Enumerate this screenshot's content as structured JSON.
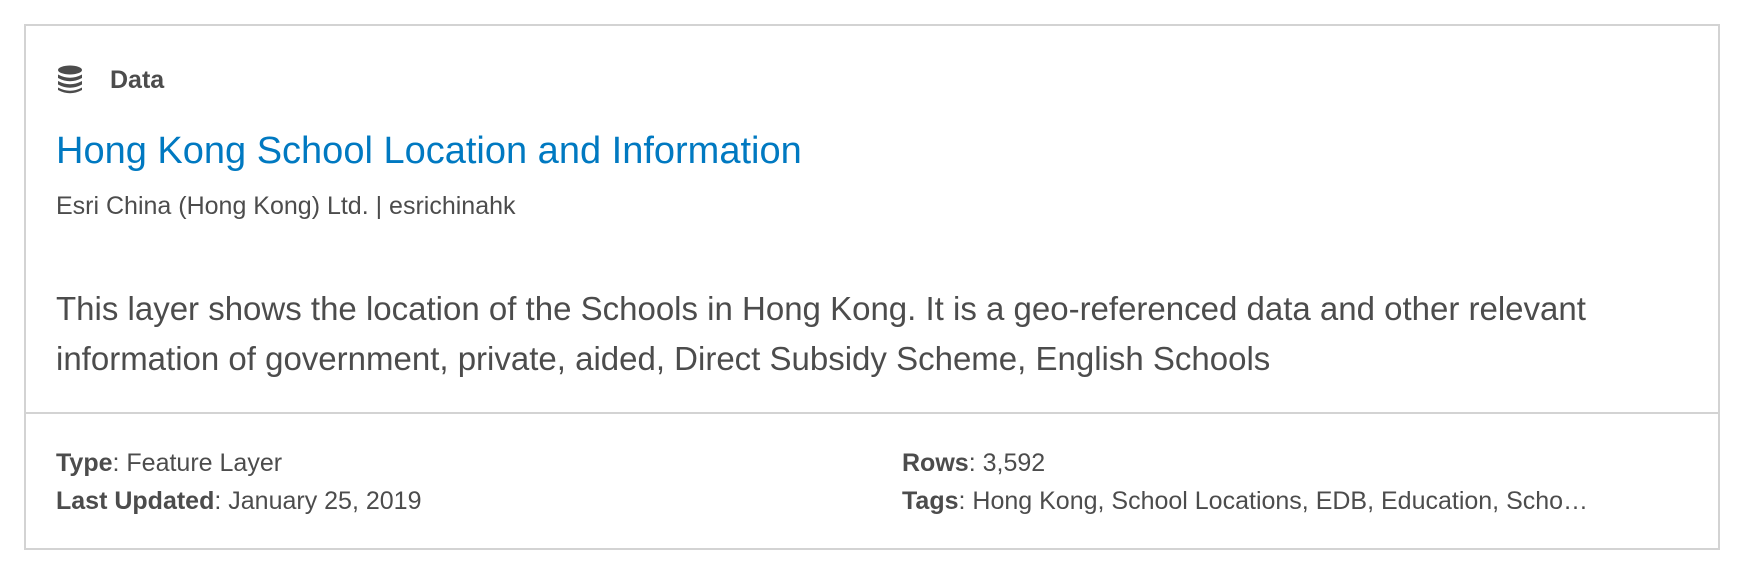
{
  "card": {
    "item_type": "Data",
    "icon": "database-icon",
    "title": "Hong Kong School Location and Information",
    "owner": "Esri China (Hong Kong) Ltd. | esrichinahk",
    "description": "This layer shows the location of the Schools in Hong Kong. It is a geo-referenced data and other relevant information of government, private, aided, Direct Subsidy Scheme, English Schools",
    "meta": {
      "type_label": "Type",
      "type_value": "Feature Layer",
      "updated_label": "Last Updated",
      "updated_value": "January 25, 2019",
      "rows_label": "Rows",
      "rows_value": "3,592",
      "tags_label": "Tags",
      "tags_value": "Hong Kong, School Locations, EDB, Education, Scho…"
    }
  },
  "colors": {
    "title": "#0079c1",
    "text": "#4c4c4c",
    "border": "#d3d3d3"
  }
}
